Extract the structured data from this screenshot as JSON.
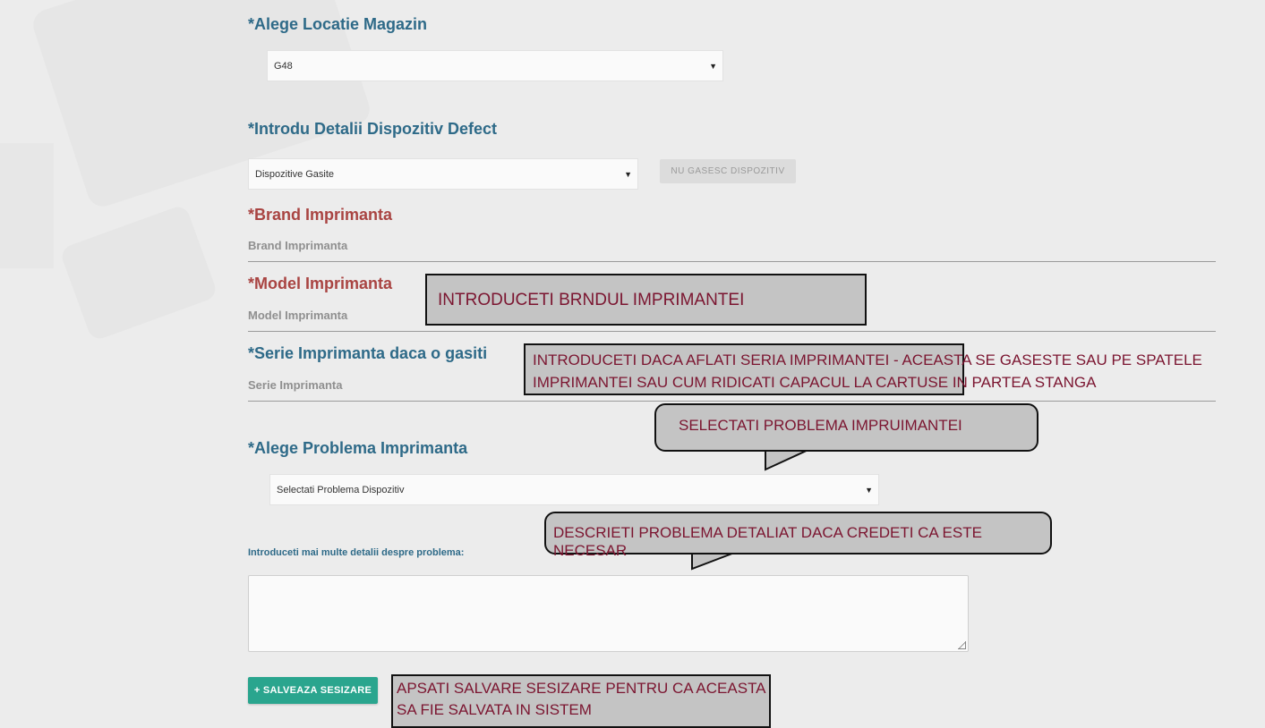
{
  "store_section": {
    "heading": "*Alege Locatie Magazin",
    "select_value": "G48"
  },
  "device_section": {
    "heading": "*Introdu Detalii Dispozitiv Defect",
    "select_value": "Dispozitive Gasite",
    "not_found_button": "NU GASESC DISPOZITIV"
  },
  "brand": {
    "heading": "*Brand Imprimanta",
    "placeholder": "Brand Imprimanta"
  },
  "model": {
    "heading": "*Model Imprimanta",
    "placeholder": "Model Imprimanta"
  },
  "serial": {
    "heading": "*Serie Imprimanta daca o gasiti",
    "placeholder": "Serie Imprimanta"
  },
  "problem": {
    "heading": "*Alege Problema Imprimanta",
    "select_value": "Selectati Problema Dispozitiv"
  },
  "details": {
    "label": "Introduceti mai multe detalii despre problema:"
  },
  "save_button": "+ SALVEAZA SESIZARE",
  "callouts": {
    "brand": "INTRODUCETI BRNDUL IMPRIMANTEI",
    "serial_line1": "INTRODUCETI DACA AFLATI SERIA IMPRIMANTEI - ACEASTA SE GASESTE SAU PE SPATELE",
    "serial_line2": "IMPRIMANTEI SAU CUM RIDICATI CAPACUL LA CARTUSE IN PARTEA STANGA",
    "problem": "SELECTATI PROBLEMA IMPRUIMANTEI",
    "describe": "DESCRIETI PROBLEMA DETALIAT DACA CREDETI CA ESTE NECESAR",
    "save_line1": "APSATI SALVARE SESIZARE PENTRU CA ACEASTA",
    "save_line2": "SA FIE SALVATA IN SISTEM"
  },
  "colors": {
    "heading_blue": "#2e6a88",
    "heading_red": "#a94442",
    "save_green": "#2aa58e",
    "callout_text": "#7b1530"
  }
}
